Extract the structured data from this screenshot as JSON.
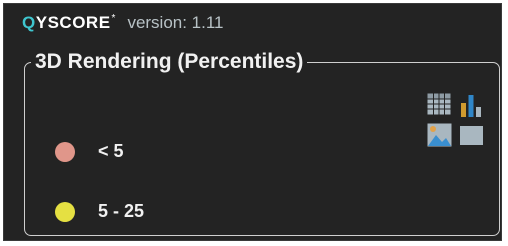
{
  "header": {
    "logo_q": "Q",
    "logo_rest": "YSCORE",
    "logo_star": "*",
    "version": "version: 1.11"
  },
  "legend": {
    "title": "3D Rendering (Percentiles)",
    "items": [
      {
        "label": "< 5",
        "color": "#e0968a"
      },
      {
        "label": "5 - 25",
        "color": "#e5e042"
      }
    ]
  },
  "toolbar": {
    "icons": [
      "table-icon",
      "bar-chart-icon",
      "image-icon",
      "blank-icon"
    ]
  },
  "colors": {
    "background": "#232323",
    "accent": "#3fc6cf",
    "border": "#cfcfcf",
    "icon": "#a9b7c0"
  }
}
